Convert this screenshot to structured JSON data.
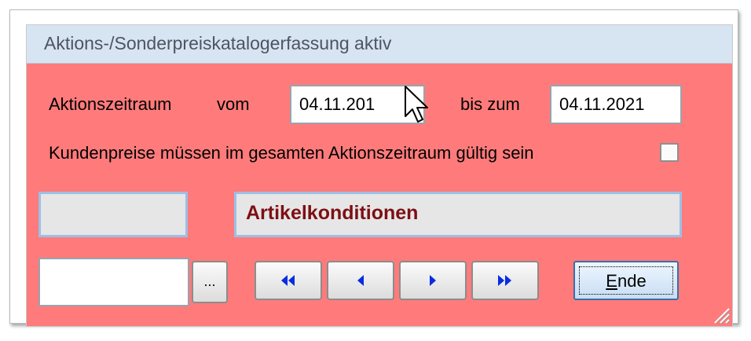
{
  "window": {
    "title": "Aktions-/Sonderpreiskatalogerfassung aktiv"
  },
  "form": {
    "period_label": "Aktionszeitraum",
    "from_label": "vom",
    "from_value": "04.11.2021",
    "from_display": "04.11.201",
    "to_label": "bis zum",
    "to_value": "04.11.2021",
    "validity_label": "Kundenpreise müssen im gesamten Aktionszeitraum gültig sein",
    "validity_checked": false
  },
  "conditions": {
    "left_value": "",
    "title": "Artikelkonditionen"
  },
  "navigation": {
    "input_value": "",
    "browse_label": "...",
    "first_icon": "first-record-icon",
    "prev_icon": "previous-record-icon",
    "next_icon": "next-record-icon",
    "last_icon": "last-record-icon",
    "end_label": "Ende"
  },
  "colors": {
    "panel_background": "#ff7b7b",
    "title_background": "#d7e4f2",
    "condition_text": "#7d0f14",
    "nav_arrow": "#0a2be0"
  }
}
